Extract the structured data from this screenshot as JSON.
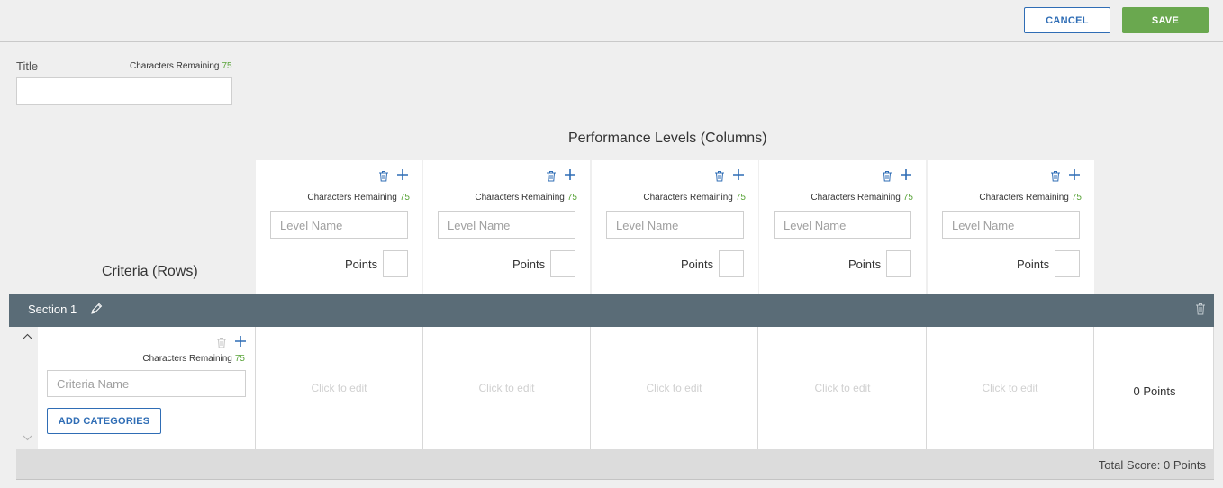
{
  "header": {
    "cancel_label": "CANCEL",
    "save_label": "SAVE"
  },
  "title_field": {
    "label": "Title",
    "chars_label": "Characters Remaining",
    "chars_count": "75",
    "value": ""
  },
  "performance": {
    "heading": "Performance Levels (Columns)",
    "levels": [
      {
        "chars_label": "Characters Remaining",
        "chars_count": "75",
        "placeholder": "Level Name",
        "points_label": "Points"
      },
      {
        "chars_label": "Characters Remaining",
        "chars_count": "75",
        "placeholder": "Level Name",
        "points_label": "Points"
      },
      {
        "chars_label": "Characters Remaining",
        "chars_count": "75",
        "placeholder": "Level Name",
        "points_label": "Points"
      },
      {
        "chars_label": "Characters Remaining",
        "chars_count": "75",
        "placeholder": "Level Name",
        "points_label": "Points"
      },
      {
        "chars_label": "Characters Remaining",
        "chars_count": "75",
        "placeholder": "Level Name",
        "points_label": "Points"
      }
    ]
  },
  "criteria": {
    "heading": "Criteria (Rows)",
    "section": {
      "name": "Section 1"
    },
    "row": {
      "chars_label": "Characters Remaining",
      "chars_count": "75",
      "placeholder": "Criteria Name",
      "add_categories_label": "ADD CATEGORIES",
      "cells": [
        "Click to edit",
        "Click to edit",
        "Click to edit",
        "Click to edit",
        "Click to edit"
      ],
      "points": "0 Points"
    }
  },
  "total": {
    "label": "Total Score: 0 Points"
  },
  "colors": {
    "accent_blue": "#2f6db5",
    "save_green": "#6aa84f",
    "count_green": "#5aa43a",
    "section_bar": "#5a6c77"
  },
  "icons": [
    "trash-icon",
    "plus-icon",
    "pencil-icon",
    "chevron-up-icon",
    "chevron-down-icon"
  ]
}
